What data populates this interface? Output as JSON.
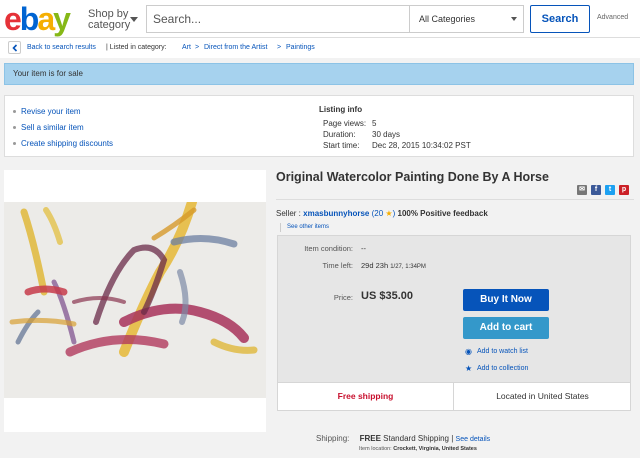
{
  "header": {
    "logo": {
      "e": "e",
      "b": "b",
      "a": "a",
      "y": "y"
    },
    "shop_by_line1": "Shop by",
    "shop_by_line2": "category",
    "search_placeholder": "Search...",
    "category_select": "All Categories",
    "search_button": "Search",
    "advanced": "Advanced"
  },
  "breadcrumb": {
    "back": "Back to search results",
    "listed": "| Listed in category:",
    "items": [
      "Art",
      "Direct from the Artist",
      "Paintings"
    ],
    "separator": ">"
  },
  "banner": "Your item is for sale",
  "seller_tools": {
    "links": [
      "Revise your item",
      "Sell a similar item",
      "Create shipping discounts"
    ],
    "listing_info_title": "Listing info",
    "rows": [
      {
        "label": "Page views:",
        "value": "5"
      },
      {
        "label": "Duration:",
        "value": "30 days"
      },
      {
        "label": "Start time:",
        "value": "Dec 28, 2015 10:34:02 PST"
      }
    ]
  },
  "item": {
    "title": "Original Watercolor Painting Done By A Horse",
    "seller_prefix": "Seller :",
    "seller_name": "xmasbunnyhorse",
    "feedback_count": "(20",
    "feedback_close": ")",
    "positive": "100% Positive feedback",
    "see_other": "See other items"
  },
  "panel": {
    "condition_label": "Item condition:",
    "condition_value": "--",
    "time_left_label": "Time left:",
    "time_left_value": "29d 23h",
    "time_left_end": "1/27, 1:34PM",
    "price_label": "Price:",
    "price_value": "US $35.00",
    "buy_now": "Buy It Now",
    "add_to_cart": "Add to cart",
    "watch": "Add to watch list",
    "collection": "Add to collection",
    "free_shipping": "Free shipping",
    "located": "Located in United States"
  },
  "shipping": {
    "label": "Shipping:",
    "free": "FREE",
    "standard": "Standard Shipping |",
    "details": "See details",
    "location_label": "Item location:",
    "location_value": "Crockett, Virginia, United States"
  },
  "colors": {
    "ebay_red": "#e53238",
    "ebay_blue": "#0654ba",
    "ebay_yellow": "#f5af02",
    "ebay_green": "#86b817",
    "banner": "#a6d2ee",
    "buy_now": "#0654ba",
    "add_to_cart": "#3498ca",
    "free_shipping": "#c8102e"
  },
  "icons": [
    "back-chevron-icon",
    "caret-down-icon",
    "eye-icon",
    "star-icon",
    "email-icon",
    "facebook-icon",
    "twitter-icon",
    "pinterest-icon"
  ]
}
